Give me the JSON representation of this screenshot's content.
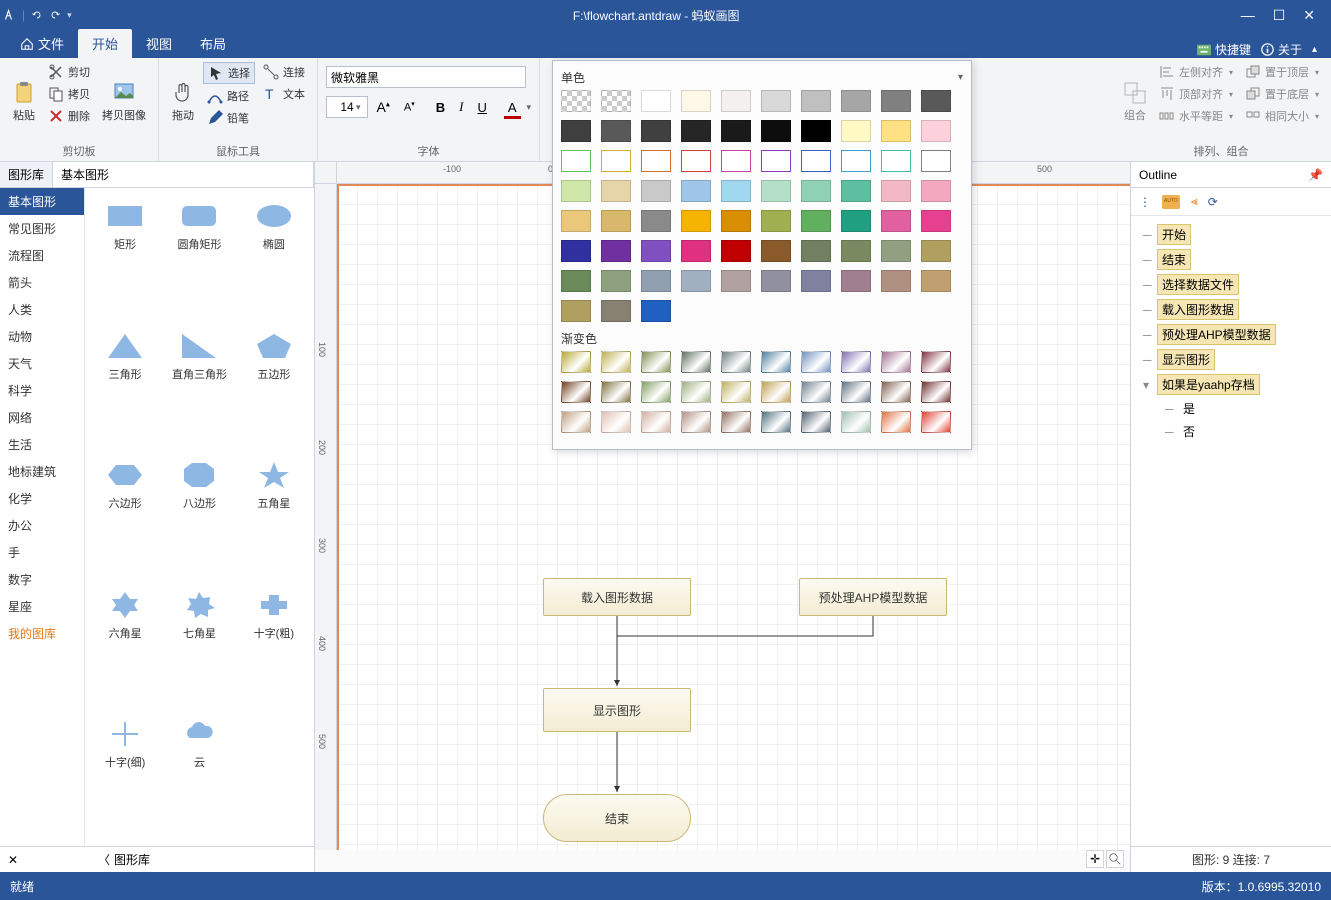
{
  "titlebar": {
    "filepath": "F:\\flowchart.antdraw - 蚂蚁画图"
  },
  "tabs": {
    "file": "文件",
    "start": "开始",
    "view": "视图",
    "layout": "布局"
  },
  "topright": {
    "shortcut": "快捷键",
    "about": "关于"
  },
  "ribbon": {
    "clipboard": {
      "paste": "粘贴",
      "cut": "剪切",
      "copy": "拷贝",
      "delete": "删除",
      "copy_image": "拷贝图像",
      "label": "剪切板"
    },
    "tools": {
      "drag": "拖动",
      "select": "选择",
      "connect": "连接",
      "path": "路径",
      "text": "文本",
      "pencil": "铅笔",
      "label": "鼠标工具"
    },
    "font": {
      "name": "微软雅黑",
      "size": "14",
      "label": "字体"
    },
    "arrange": {
      "combine": "组合",
      "align_left": "左侧对齐",
      "align_top": "顶部对齐",
      "hspace": "水平等距",
      "put_top": "置于顶层",
      "put_bottom": "置于底层",
      "same_size": "相同大小",
      "label": "排列、组合"
    }
  },
  "shapepanel": {
    "tab1": "图形库",
    "tab2": "基本图形",
    "categories": [
      "基本图形",
      "常见图形",
      "流程图",
      "箭头",
      "人类",
      "动物",
      "天气",
      "科学",
      "网络",
      "生活",
      "地标建筑",
      "化学",
      "办公",
      "手",
      "数字",
      "星座"
    ],
    "my_lib": "我的图库",
    "shapes": [
      {
        "name": "矩形"
      },
      {
        "name": "圆角矩形"
      },
      {
        "name": "椭圆"
      },
      {
        "name": "三角形"
      },
      {
        "name": "直角三角形"
      },
      {
        "name": "五边形"
      },
      {
        "name": "六边形"
      },
      {
        "name": "八边形"
      },
      {
        "name": "五角星"
      },
      {
        "name": "六角星"
      },
      {
        "name": "七角星"
      },
      {
        "name": "十字(粗)"
      },
      {
        "name": "十字(细)"
      },
      {
        "name": "云"
      }
    ],
    "back": "图形库"
  },
  "canvas": {
    "boxes": {
      "load_data": "载入图形数据",
      "ahp": "预处理AHP模型数据",
      "show": "显示图形",
      "end": "结束"
    }
  },
  "colorpopup": {
    "solid": "单色",
    "gradient": "渐变色",
    "solid_rows": [
      [
        "#888",
        "#888",
        "#ffffff",
        "#fff8e8",
        "#f4f0f0",
        "#d9d9d9",
        "#c0c0c0",
        "#a6a6a6",
        "#808080",
        "#595959"
      ],
      [
        "#3f3f3f",
        "#595959",
        "#404040",
        "#262626",
        "#1a1a1a",
        "#0d0d0d",
        "#000000",
        "#fff9c4",
        "#ffe082",
        "#fdd1dc"
      ],
      [
        "#cfe7a8",
        "#e6d5a8",
        "#c9c9c9",
        "#9fc5e8",
        "#a0d8ef",
        "#b4e0c8",
        "#8ed1b5",
        "#5ebfa0",
        "#f2b8c6",
        "#f4a8c0"
      ],
      [
        "#eac77a",
        "#d8b96b",
        "#8a8a8a",
        "#f4b400",
        "#d98e04",
        "#a0b050",
        "#60b060",
        "#20a080",
        "#e060a0",
        "#e84090"
      ],
      [
        "#3030a0",
        "#7030a0",
        "#8050c0",
        "#e03080",
        "#c00000",
        "#8a5a2b",
        "#708060",
        "#7a8a60",
        "#90a080",
        "#b0a060"
      ],
      [
        "#6a8a5a",
        "#8ea080",
        "#90a0b0",
        "#a0b0c0",
        "#b0a0a0",
        "#9090a0",
        "#8080a0",
        "#a08090",
        "#b09080",
        "#c0a070"
      ],
      [
        "#b0a060",
        "#888070"
      ],
      [
        "#2060c0"
      ]
    ],
    "outline_colors": [
      "#60c060",
      "#d0b030",
      "#d07030",
      "#d04040",
      "#d040a0",
      "#8040c0",
      "#4060c0",
      "#40a0d0",
      "#40c0a0",
      "#808080"
    ],
    "gradient_rows": [
      [
        "#b8a830",
        "#c0b050",
        "#809050",
        "#607060",
        "#708080",
        "#5080a0",
        "#7090c0",
        "#8070b0",
        "#a07090",
        "#803040"
      ],
      [
        "#704020",
        "#807040",
        "#80a060",
        "#a0b080",
        "#c0b060",
        "#c0a050",
        "#708090",
        "#607080",
        "#806050",
        "#703030"
      ],
      [
        "#c0a080",
        "#e0c0b0",
        "#d0b0a0",
        "#b09080",
        "#907060",
        "#507080",
        "#506070",
        "#a0c0b0",
        "#e07040",
        "#e04030"
      ]
    ]
  },
  "outline": {
    "title": "Outline",
    "nodes": [
      "开始",
      "结束",
      "选择数据文件",
      "载入图形数据",
      "预处理AHP模型数据",
      "显示图形",
      "如果是yaahp存档"
    ],
    "plain": [
      "是",
      "否"
    ],
    "status": "图形: 9  连接: 7"
  },
  "status": {
    "ready": "就绪",
    "version": "版本：1.0.6995.32010"
  },
  "ruler": {
    "h": {
      "m100": "-100",
      "p0": "0",
      "p500": "500"
    },
    "v": {
      "p100": "100",
      "p200": "200",
      "p300": "300",
      "p400": "400",
      "p500": "500"
    }
  }
}
